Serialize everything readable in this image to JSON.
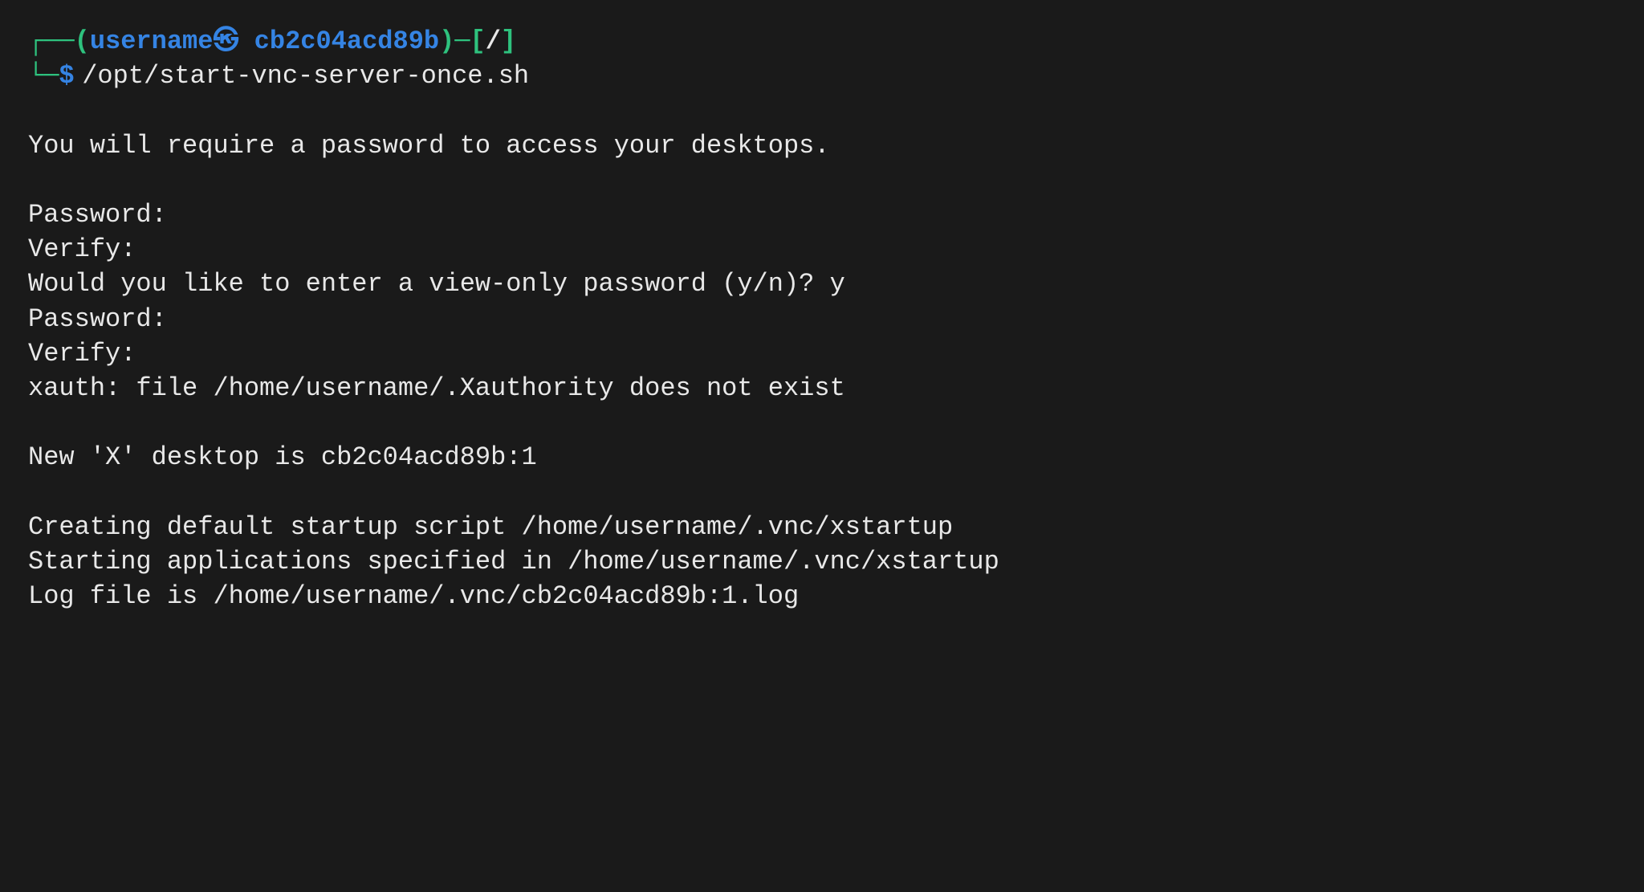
{
  "prompt": {
    "box_tl": "┌──",
    "paren_open": "(",
    "user": "username",
    "at_content": "㉿",
    "host": "cb2c04acd89b",
    "paren_close": ")",
    "dash": "─",
    "bracket_open": "[",
    "path": "/",
    "bracket_close": "]",
    "box_bl": "└─",
    "dollar": "$",
    "command": "/opt/start-vnc-server-once.sh"
  },
  "output": {
    "line1": "You will require a password to access your desktops.",
    "line2": "Password:",
    "line3": "Verify:",
    "line4": "Would you like to enter a view-only password (y/n)? y",
    "line5": "Password:",
    "line6": "Verify:",
    "line7": "xauth:  file /home/username/.Xauthority does not exist",
    "line8": "New 'X' desktop is cb2c04acd89b:1",
    "line9": "Creating default startup script /home/username/.vnc/xstartup",
    "line10": "Starting applications specified in /home/username/.vnc/xstartup",
    "line11": "Log file is /home/username/.vnc/cb2c04acd89b:1.log"
  }
}
